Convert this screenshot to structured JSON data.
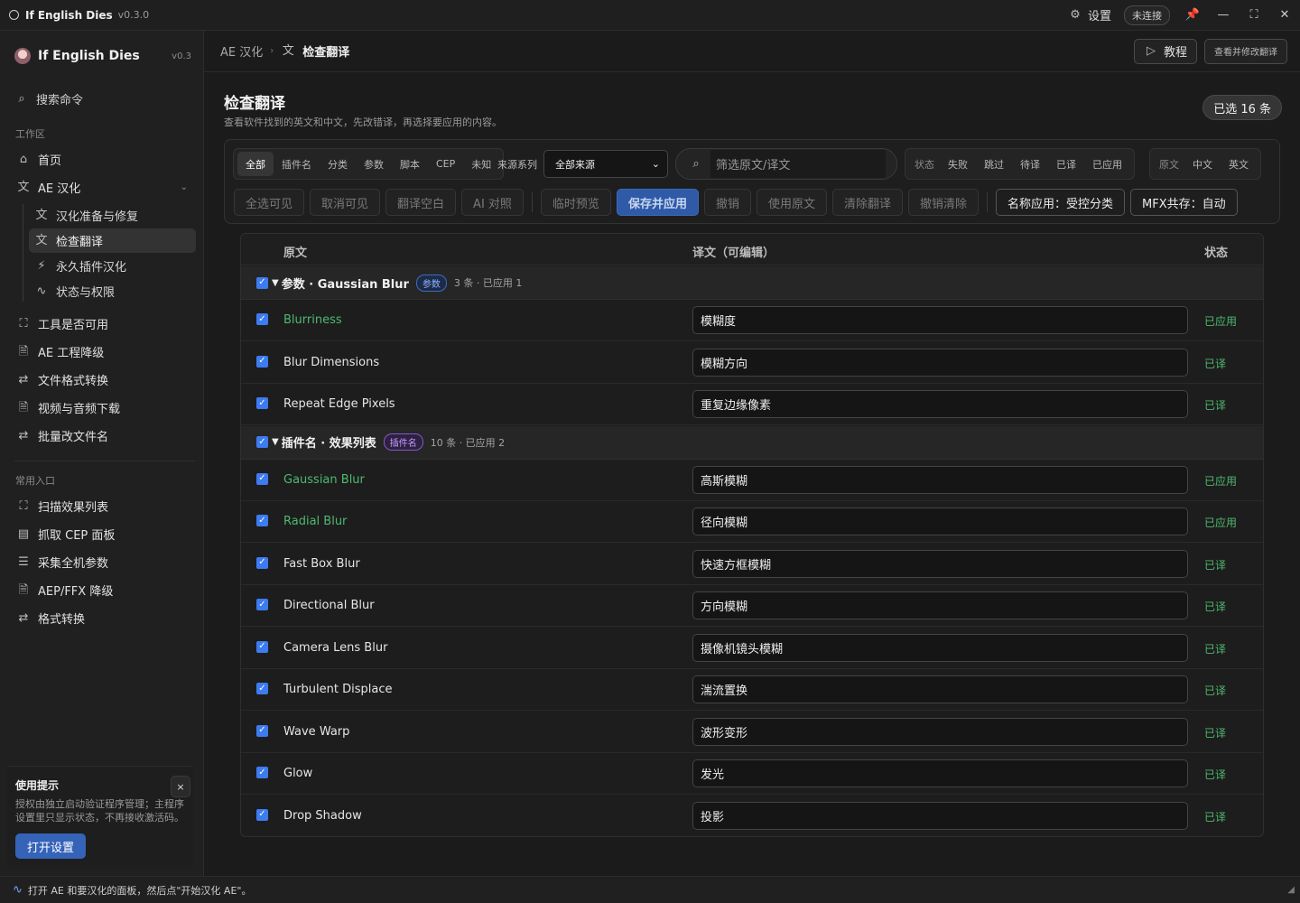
{
  "titlebar": {
    "app_name": "If English Dies",
    "version": "v0.3.0",
    "settings_label": "设置",
    "connection_status": "未连接"
  },
  "sidebar": {
    "brand_name": "If English Dies",
    "brand_version": "v0.3",
    "search_label": "搜索命令",
    "section_workspace": "工作区",
    "item_home": "首页",
    "item_ae_localize": "AE 汉化",
    "sub_items": [
      "汉化准备与修复",
      "检查翻译",
      "永久插件汉化",
      "状态与权限"
    ],
    "items_tools": [
      "工具是否可用",
      "AE 工程降级",
      "文件格式转换",
      "视频与音频下载",
      "批量改文件名"
    ],
    "section_common": "常用入口",
    "items_common": [
      "扫描效果列表",
      "抓取 CEP 面板",
      "采集全机参数",
      "AEP/FFX 降级",
      "格式转换"
    ],
    "tip": {
      "title": "使用提示",
      "text": "授权由独立启动验证程序管理；主程序设置里只显示状态，不再接收激活码。",
      "button": "打开设置"
    }
  },
  "topbar": {
    "breadcrumb_parent": "AE 汉化",
    "breadcrumb_current": "检查翻译",
    "tutorial_button": "教程",
    "review_button": "查看并修改翻译"
  },
  "page": {
    "title": "检查翻译",
    "subtitle": "查看软件找到的英文和中文，先改错译，再选择要应用的内容。",
    "selected_badge": "已选 16 条"
  },
  "filters": {
    "categories": [
      "全部",
      "插件名",
      "分类",
      "参数",
      "脚本",
      "CEP",
      "未知"
    ],
    "source_label": "来源系列",
    "source_value": "全部来源",
    "search_placeholder": "筛选原文/译文",
    "status_label": "状态",
    "status_options": [
      "失败",
      "跳过",
      "待译",
      "已译",
      "已应用"
    ],
    "lang_label": "原文",
    "lang_options": [
      "中文",
      "英文"
    ]
  },
  "actions": {
    "select_visible": "全选可见",
    "deselect_visible": "取消可见",
    "translate_blank": "翻译空白",
    "ai_compare": "AI 对照",
    "temp_preview": "临时预览",
    "save_apply": "保存并应用",
    "undo": "撤销",
    "use_original": "使用原文",
    "clear_translation": "清除翻译",
    "undo_clear": "撤销清除",
    "name_apply": "名称应用：受控分类",
    "mfx_coexist": "MFX共存：自动"
  },
  "table": {
    "col_source": "原文",
    "col_translation": "译文（可编辑）",
    "col_status": "状态",
    "groups": [
      {
        "title": "参数 · Gaussian Blur",
        "tag": "参数",
        "meta": "3 条 · 已应用 1",
        "rows": [
          {
            "en": "Blurriness",
            "zh": "模糊度",
            "status": "已应用"
          },
          {
            "en": "Blur Dimensions",
            "zh": "模糊方向",
            "status": "已译"
          },
          {
            "en": "Repeat Edge Pixels",
            "zh": "重复边缘像素",
            "status": "已译"
          }
        ]
      },
      {
        "title": "插件名 · 效果列表",
        "tag": "插件名",
        "meta": "10 条 · 已应用 2",
        "rows": [
          {
            "en": "Gaussian Blur",
            "zh": "高斯模糊",
            "status": "已应用"
          },
          {
            "en": "Radial Blur",
            "zh": "径向模糊",
            "status": "已应用"
          },
          {
            "en": "Fast Box Blur",
            "zh": "快速方框模糊",
            "status": "已译"
          },
          {
            "en": "Directional Blur",
            "zh": "方向模糊",
            "status": "已译"
          },
          {
            "en": "Camera Lens Blur",
            "zh": "摄像机镜头模糊",
            "status": "已译"
          },
          {
            "en": "Turbulent Displace",
            "zh": "湍流置换",
            "status": "已译"
          },
          {
            "en": "Wave Warp",
            "zh": "波形变形",
            "status": "已译"
          },
          {
            "en": "Glow",
            "zh": "发光",
            "status": "已译"
          },
          {
            "en": "Drop Shadow",
            "zh": "投影",
            "status": "已译"
          }
        ]
      }
    ]
  },
  "statusbar": {
    "message": "打开 AE 和要汉化的面板，然后点\"开始汉化 AE\"。"
  },
  "colors": {
    "accent": "#3d7bf0",
    "primary_button": "#2f5aa8",
    "status_green": "#4fb970"
  }
}
